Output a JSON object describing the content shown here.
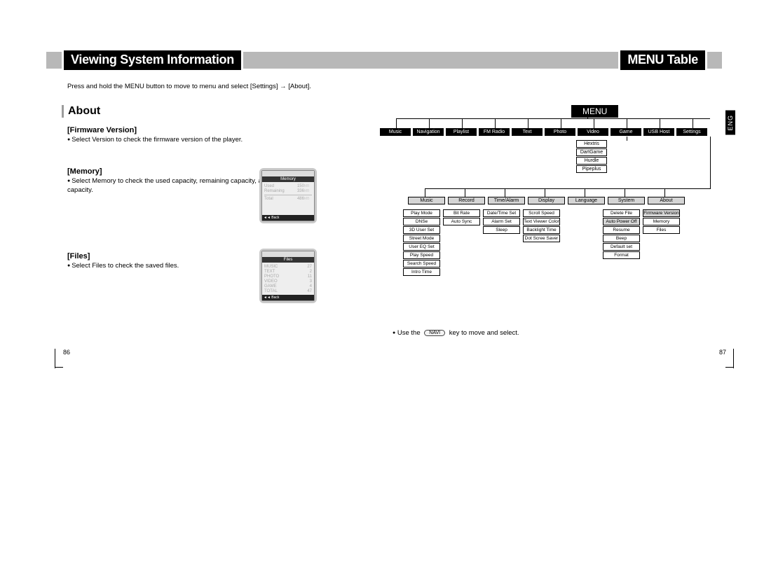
{
  "header": {
    "left_title": "Viewing System Information",
    "right_title": "MENU Table",
    "subnote": "Press and hold the MENU button to move to menu and select [Settings] → [About]."
  },
  "left": {
    "about": "About",
    "firmware_h": "[Firmware Version]",
    "firmware_b": "Select Version to check the firmware version of the player.",
    "memory_h": "[Memory]",
    "memory_b": "Select Memory to check the used capacity, remaining capacity, and total capacity.",
    "files_h": "[Files]",
    "files_b": "Select Files to check the saved files."
  },
  "ss_mem": {
    "title": "Memory",
    "rows": [
      [
        "Used",
        "150",
        "MB"
      ],
      [
        "Remaining",
        "336",
        "MB"
      ],
      [
        "Total",
        "486",
        "MB"
      ]
    ],
    "back": "◄◄ Back"
  },
  "ss_files": {
    "title": "Files",
    "rows": [
      [
        "MUSIC",
        "27"
      ],
      [
        "TEXT",
        "2"
      ],
      [
        "PHOTO",
        "11"
      ],
      [
        "VIDEO",
        "3"
      ],
      [
        "GAME",
        "4"
      ],
      [
        "TOTAL",
        "47"
      ]
    ],
    "back": "◄◄ Back"
  },
  "right": {
    "menu": "MENU",
    "eng": "ENG",
    "top_row": [
      "Music",
      "Navigation",
      "Playlist",
      "FM Radio",
      "Text",
      "Photo",
      "Video",
      "Game",
      "USB Host",
      "Settings"
    ],
    "games": [
      "Hextris",
      "DartGame",
      "Hurdle",
      "Pipeplus"
    ],
    "settings_row": [
      "Music",
      "Record",
      "Time/Alarm",
      "Display",
      "Language",
      "System",
      "About"
    ],
    "cols": {
      "music": [
        "Play Mode",
        "DNSe",
        "3D User Set",
        "Street Mode",
        "User EQ Set",
        "Play Speed",
        "Search Speed",
        "Intro Time"
      ],
      "record": [
        "Bit Rate",
        "Auto Sync"
      ],
      "time": [
        "Date/Time Set",
        "Alarm Set",
        "Sleep"
      ],
      "display": [
        "Scroll Speed",
        "Text Viewer Color",
        "Backlight Time",
        "Dot Scree Saver"
      ],
      "language": [],
      "system": [
        "Delete File",
        "Auto Power Off",
        "Resume",
        "Beep",
        "Default set",
        "Format"
      ],
      "about": [
        "Firmware Version",
        "Memory",
        "Files"
      ]
    },
    "use_text_a": "Use the",
    "use_text_b": "key to move and select.",
    "navi": "NAVI"
  },
  "pages": {
    "left": "86",
    "right": "87"
  }
}
